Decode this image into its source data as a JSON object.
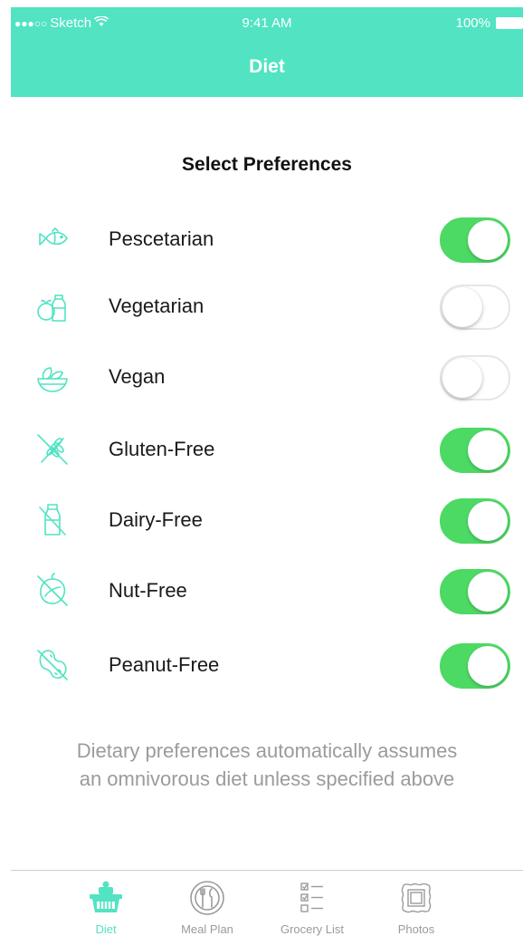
{
  "status_bar": {
    "carrier": "Sketch",
    "time": "9:41 AM",
    "battery": "100%"
  },
  "nav": {
    "title": "Diet"
  },
  "content": {
    "section_title": "Select Preferences",
    "preferences": [
      {
        "label": "Pescetarian",
        "icon": "fish-icon",
        "enabled": true
      },
      {
        "label": "Vegetarian",
        "icon": "vegetables-milk-icon",
        "enabled": false
      },
      {
        "label": "Vegan",
        "icon": "salad-bowl-icon",
        "enabled": false
      },
      {
        "label": "Gluten-Free",
        "icon": "wheat-crossed-icon",
        "enabled": true
      },
      {
        "label": "Dairy-Free",
        "icon": "milk-crossed-icon",
        "enabled": true
      },
      {
        "label": "Nut-Free",
        "icon": "nut-crossed-icon",
        "enabled": true
      },
      {
        "label": "Peanut-Free",
        "icon": "peanut-crossed-icon",
        "enabled": true
      }
    ],
    "footnote": "Dietary preferences automatically assumes an omnivorous diet unless specified above"
  },
  "tab_bar": {
    "tabs": [
      {
        "label": "Diet",
        "icon": "basket-icon",
        "active": true
      },
      {
        "label": "Meal Plan",
        "icon": "plate-utensils-icon",
        "active": false
      },
      {
        "label": "Grocery List",
        "icon": "checklist-icon",
        "active": false
      },
      {
        "label": "Photos",
        "icon": "photo-frame-icon",
        "active": false
      }
    ]
  },
  "colors": {
    "accent": "#51E3C2",
    "toggle_on": "#4CD964",
    "toggle_off_border": "#E6E6E6",
    "muted_text": "#9B9B9B"
  }
}
